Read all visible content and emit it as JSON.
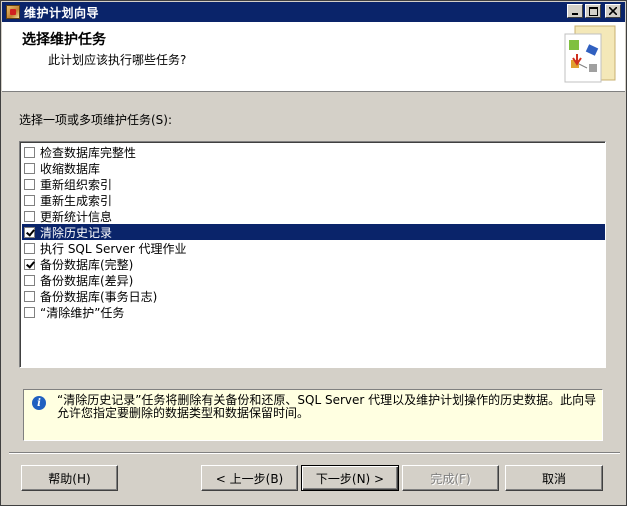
{
  "window": {
    "title": "维护计划向导",
    "controls": [
      "minimize",
      "maximize",
      "close"
    ]
  },
  "header": {
    "title": "选择维护任务",
    "subtitle": "此计划应该执行哪些任务?"
  },
  "prompt": "选择一项或多项维护任务(S):",
  "tasks": [
    {
      "label": "检查数据库完整性",
      "checked": false,
      "selected": false
    },
    {
      "label": "收缩数据库",
      "checked": false,
      "selected": false
    },
    {
      "label": "重新组织索引",
      "checked": false,
      "selected": false
    },
    {
      "label": "重新生成索引",
      "checked": false,
      "selected": false
    },
    {
      "label": "更新统计信息",
      "checked": false,
      "selected": false
    },
    {
      "label": "清除历史记录",
      "checked": true,
      "selected": true
    },
    {
      "label": "执行 SQL Server 代理作业",
      "checked": false,
      "selected": false
    },
    {
      "label": "备份数据库(完整)",
      "checked": true,
      "selected": false
    },
    {
      "label": "备份数据库(差异)",
      "checked": false,
      "selected": false
    },
    {
      "label": "备份数据库(事务日志)",
      "checked": false,
      "selected": false
    },
    {
      "label": "“清除维护”任务",
      "checked": false,
      "selected": false
    }
  ],
  "info": {
    "icon": "info-icon",
    "text": "“清除历史记录”任务将删除有关备份和还原、SQL Server 代理以及维护计划操作的历史数据。此向导允许您指定要删除的数据类型和数据保留时间。"
  },
  "buttons": {
    "help": "帮助(H)",
    "back": "< 上一步(B)",
    "next": "下一步(N) >",
    "finish": "完成(F)",
    "cancel": "取消"
  },
  "colors": {
    "titlebar": "#0a246a",
    "selection": "#0a246a",
    "face": "#d4d0c8",
    "info_bg": "#ffffe1"
  }
}
